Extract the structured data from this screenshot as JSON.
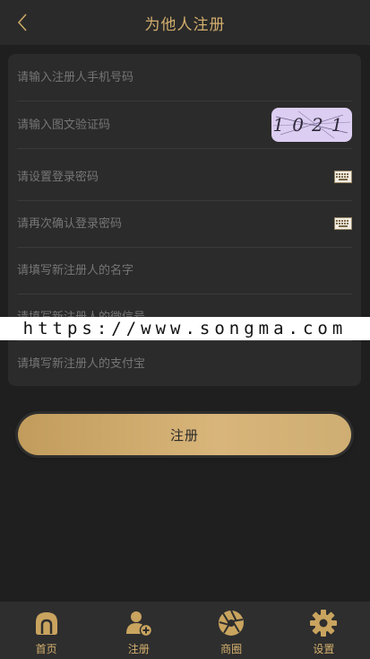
{
  "header": {
    "title": "为他人注册",
    "back_icon": "chevron-left-icon"
  },
  "form": {
    "phone_placeholder": "请输入注册人手机号码",
    "captcha_placeholder": "请输入图文验证码",
    "captcha_text": "1021",
    "password_placeholder": "请设置登录密码",
    "confirm_password_placeholder": "请再次确认登录密码",
    "name_placeholder": "请填写新注册人的名字",
    "wechat_placeholder": "请填写新注册人的微信号",
    "alipay_placeholder": "请填写新注册人的支付宝"
  },
  "watermark": "https://www.songma.com",
  "submit_label": "注册",
  "tabbar": {
    "items": [
      {
        "label": "首页",
        "icon": "home-icon"
      },
      {
        "label": "注册",
        "icon": "add-user-icon"
      },
      {
        "label": "商圈",
        "icon": "aperture-icon"
      },
      {
        "label": "设置",
        "icon": "gear-icon"
      }
    ]
  },
  "colors": {
    "accent": "#d4b06e",
    "background": "#1f1f1f",
    "card": "#2b2b2b"
  }
}
